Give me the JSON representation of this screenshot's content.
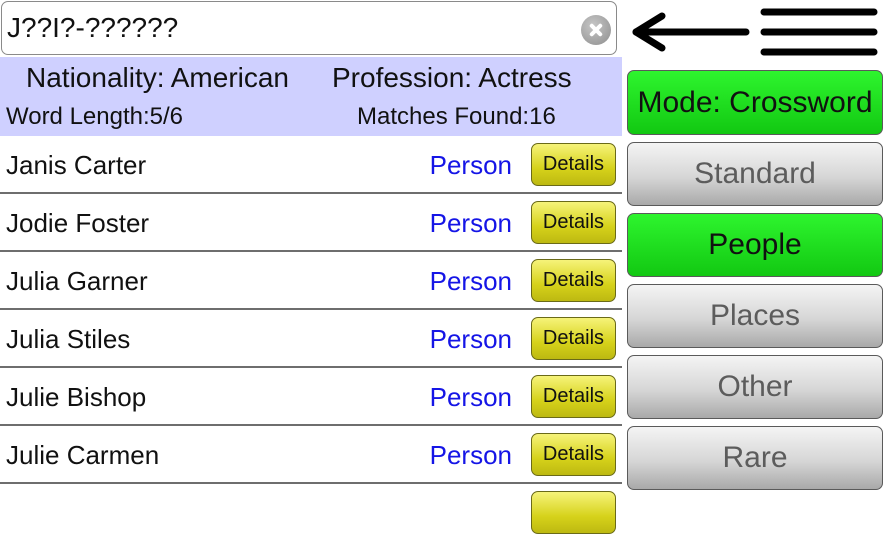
{
  "search": {
    "value": "J??I?-??????",
    "clear_icon": "clear-x-circle-icon"
  },
  "nav": {
    "back_icon": "back-arrow-icon",
    "menu_icon": "hamburger-menu-icon"
  },
  "info": {
    "nationality": "Nationality: American",
    "profession": "Profession: Actress",
    "word_length": "Word Length:5/6",
    "matches_found": "Matches Found:16"
  },
  "results": [
    {
      "name": "Janis Carter",
      "type": "Person",
      "details_label": "Details"
    },
    {
      "name": "Jodie Foster",
      "type": "Person",
      "details_label": "Details"
    },
    {
      "name": "Julia Garner",
      "type": "Person",
      "details_label": "Details"
    },
    {
      "name": "Julia Stiles",
      "type": "Person",
      "details_label": "Details"
    },
    {
      "name": "Julie Bishop",
      "type": "Person",
      "details_label": "Details"
    },
    {
      "name": "Julie Carmen",
      "type": "Person",
      "details_label": "Details"
    }
  ],
  "sidebar": {
    "mode_label": "Mode: Crossword",
    "categories": [
      {
        "label": "Standard",
        "active": false
      },
      {
        "label": "People",
        "active": true
      },
      {
        "label": "Places",
        "active": false
      },
      {
        "label": "Other",
        "active": false
      },
      {
        "label": "Rare",
        "active": false
      }
    ]
  },
  "colors": {
    "active_green": "#1ee01e",
    "info_panel": "#cfd0ff",
    "type_blue": "#1515e6",
    "details_yellow": "#e0dc2a"
  }
}
